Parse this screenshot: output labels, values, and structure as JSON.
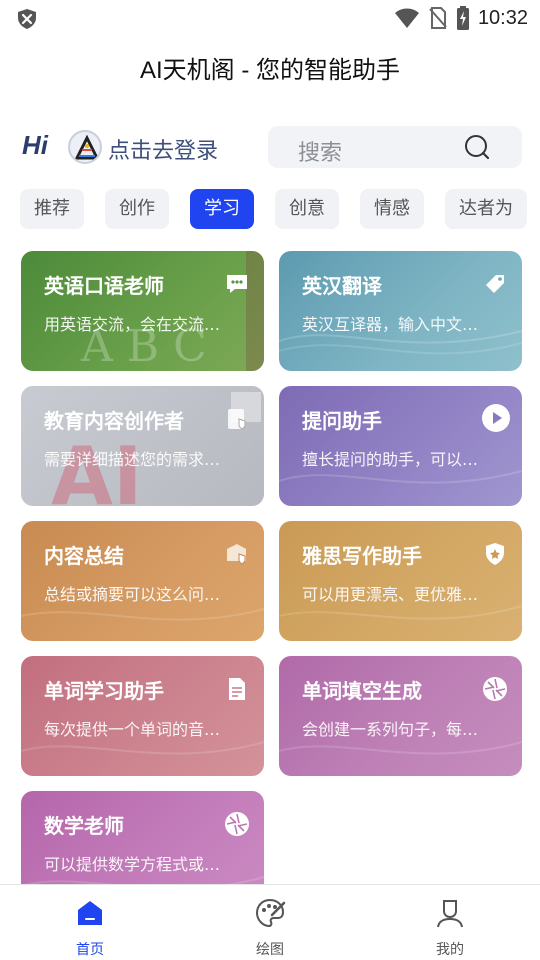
{
  "status_bar": {
    "time": "10:32"
  },
  "app": {
    "title": "AI天机阁 - 您的智能助手"
  },
  "header": {
    "hi_logo": "Hi",
    "login_label": "点击去登录",
    "search_placeholder": "搜索"
  },
  "tabs": [
    {
      "label": "推荐"
    },
    {
      "label": "创作"
    },
    {
      "label": "学习"
    },
    {
      "label": "创意"
    },
    {
      "label": "情感"
    },
    {
      "label": "达者为"
    }
  ],
  "active_tab_index": 2,
  "cards": [
    {
      "title": "英语口语老师",
      "desc": "用英语交流，会在交流…",
      "icon": "chat-bubble-icon"
    },
    {
      "title": "英汉翻译",
      "desc": "英汉互译器，输入中文…",
      "icon": "tag-icon"
    },
    {
      "title": "教育内容创作者",
      "desc": "需要详细描述您的需求…",
      "icon": "document-shield-icon"
    },
    {
      "title": "提问助手",
      "desc": "擅长提问的助手，可以…",
      "icon": "play-icon"
    },
    {
      "title": "内容总结",
      "desc": "总结或摘要可以这么问…",
      "icon": "box-shield-icon"
    },
    {
      "title": "雅思写作助手",
      "desc": "可以用更漂亮、更优雅…",
      "icon": "shield-star-icon"
    },
    {
      "title": "单词学习助手",
      "desc": "每次提供一个单词的音…",
      "icon": "document-icon"
    },
    {
      "title": "单词填空生成",
      "desc": "会创建一系列句子，每…",
      "icon": "aperture-icon"
    },
    {
      "title": "数学老师",
      "desc": "可以提供数学方程式或…",
      "icon": "aperture-icon"
    }
  ],
  "bottom_nav": [
    {
      "label": "首页",
      "icon": "home-icon"
    },
    {
      "label": "绘图",
      "icon": "palette-icon"
    },
    {
      "label": "我的",
      "icon": "user-icon"
    }
  ],
  "colors": {
    "accent": "#1f44f0"
  }
}
